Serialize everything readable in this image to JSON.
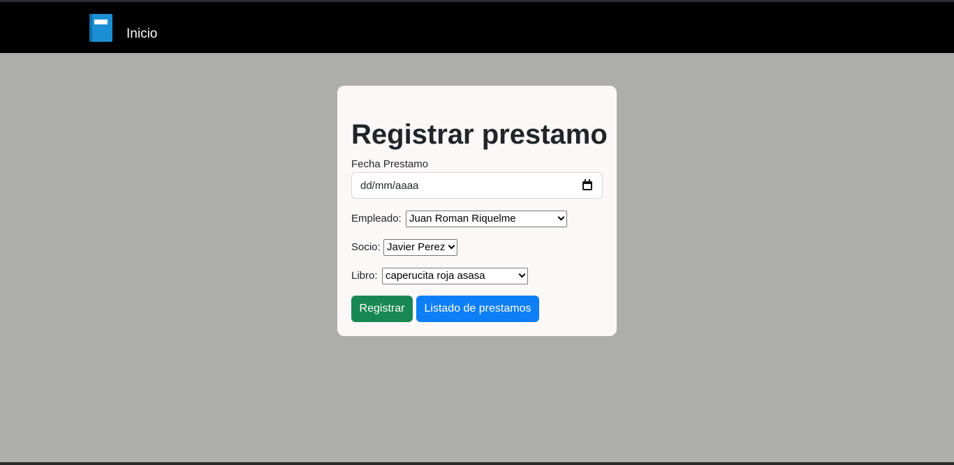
{
  "navbar": {
    "brand_icon": "book-icon",
    "home_label": "Inicio"
  },
  "form": {
    "title": "Registrar prestamo",
    "date_label": "Fecha Prestamo",
    "date_placeholder": "dd/mm/aaaa",
    "employee_label": "Empleado:",
    "employee_value": "Juan Roman Riquelme",
    "member_label": "Socio:",
    "member_value": "Javier Perez",
    "book_label": "Libro:",
    "book_value": "caperucita roja asasa",
    "submit_label": "Registrar",
    "list_label": "Listado de prestamos"
  },
  "colors": {
    "navbar": "#000000",
    "background": "#adadab",
    "card": "#fdf8f8",
    "submit": "#198754",
    "list": "#0d7ef5",
    "brand_icon": "#1c8fd4"
  }
}
